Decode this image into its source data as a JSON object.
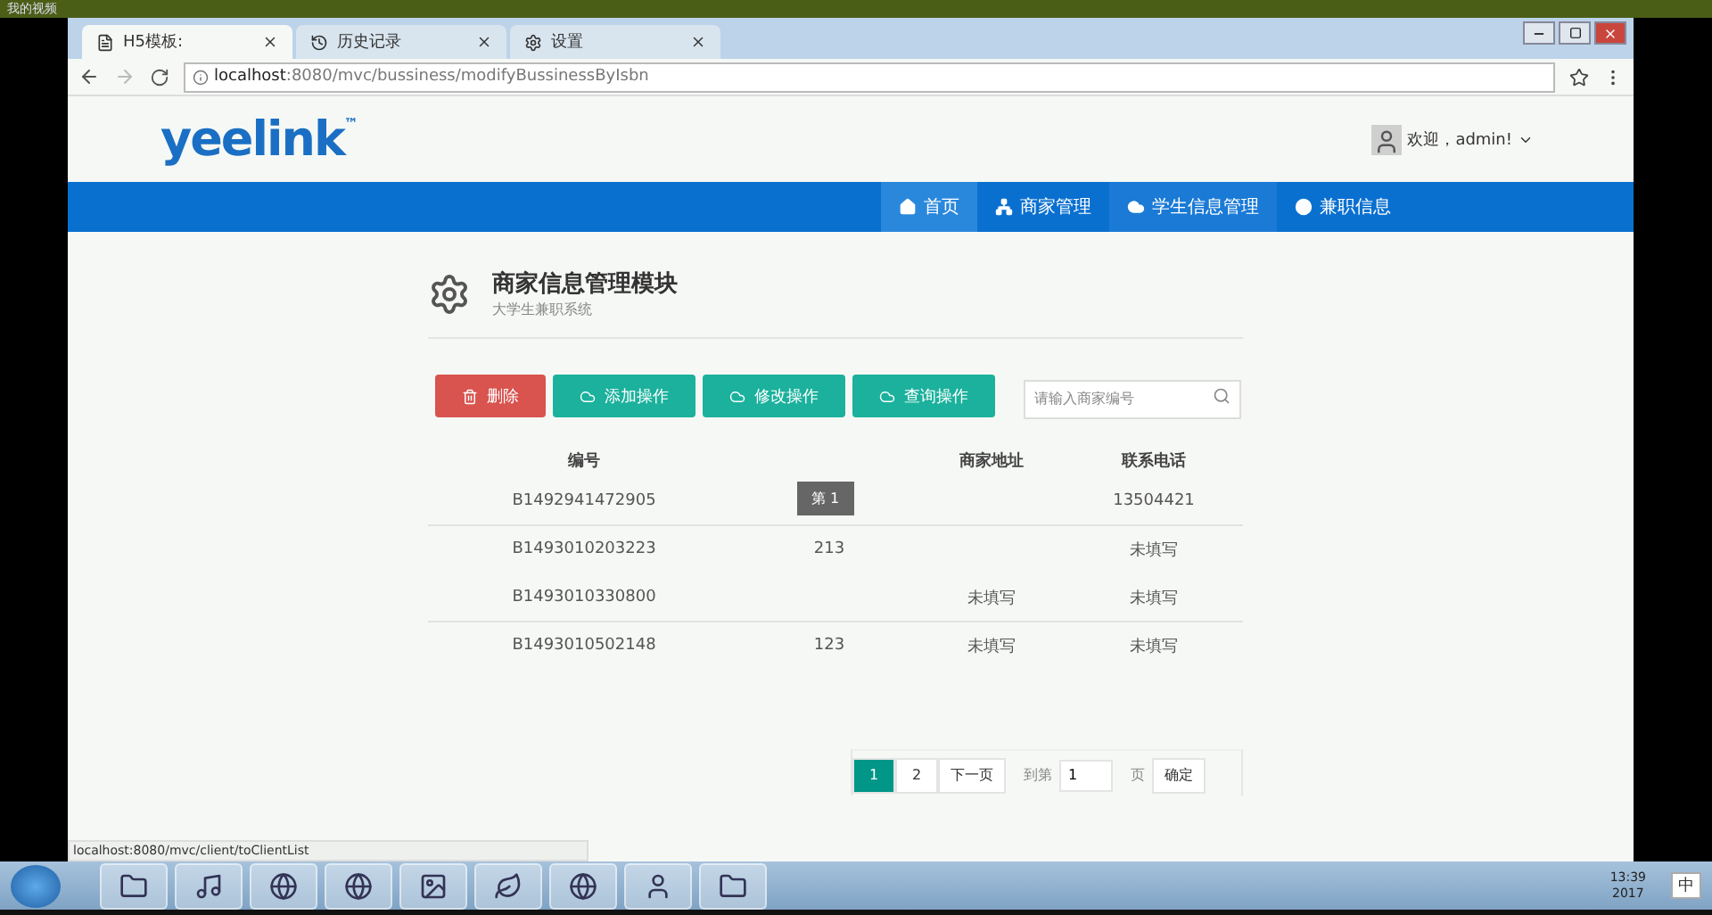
{
  "player": {
    "title": "我的视频"
  },
  "browser": {
    "tabs": [
      {
        "label": "H5模板:",
        "selected": true
      },
      {
        "label": "历史记录",
        "selected": false
      },
      {
        "label": "设置",
        "selected": false
      }
    ],
    "address": {
      "host": "localhost",
      "path": ":8080/mvc/bussiness/modifyBussinessByIsbn"
    },
    "status_url": "localhost:8080/mvc/client/toClientList"
  },
  "header": {
    "logo": "yeelink",
    "logo_mark": "™",
    "user": "欢迎，admin!"
  },
  "nav": [
    {
      "label": "首页",
      "selected": true,
      "hovered": false
    },
    {
      "label": "商家管理",
      "selected": false,
      "hovered": false
    },
    {
      "label": "学生信息管理",
      "selected": false,
      "hovered": true
    },
    {
      "label": "兼职信息",
      "selected": false,
      "hovered": false
    }
  ],
  "module": {
    "title": "商家信息管理模块",
    "subtitle": "大学生兼职系统"
  },
  "actions": [
    {
      "label": "删除",
      "kind": "danger"
    },
    {
      "label": "添加操作",
      "kind": "primary"
    },
    {
      "label": "修改操作",
      "kind": "primary"
    },
    {
      "label": "查询操作",
      "kind": "primary"
    }
  ],
  "search": {
    "placeholder": "请输入商家编号"
  },
  "table": {
    "columns": [
      {
        "label": "编号"
      },
      {},
      {
        "label": "商家地址"
      },
      {
        "label": "联系电话"
      }
    ],
    "rows": [
      [
        "B1492941472905",
        null,
        null,
        "13504421"
      ],
      [
        "B1493010203223",
        "213",
        null,
        "未填写"
      ],
      [
        "B1493010330800",
        null,
        "未填写",
        "未填写"
      ],
      [
        "B1493010502148",
        "123",
        "未填写",
        "未填写"
      ]
    ]
  },
  "tooltip": "第 1",
  "pagination": {
    "pages": [
      {
        "label": "1",
        "selected": true
      },
      {
        "label": "2",
        "selected": false
      }
    ],
    "next": "下一页",
    "goto_prefix": "到第",
    "goto_value": "1",
    "goto_suffix": "页",
    "confirm": "确定"
  },
  "taskbar": {
    "time": "13:39",
    "date": "2017",
    "ime": "中"
  }
}
